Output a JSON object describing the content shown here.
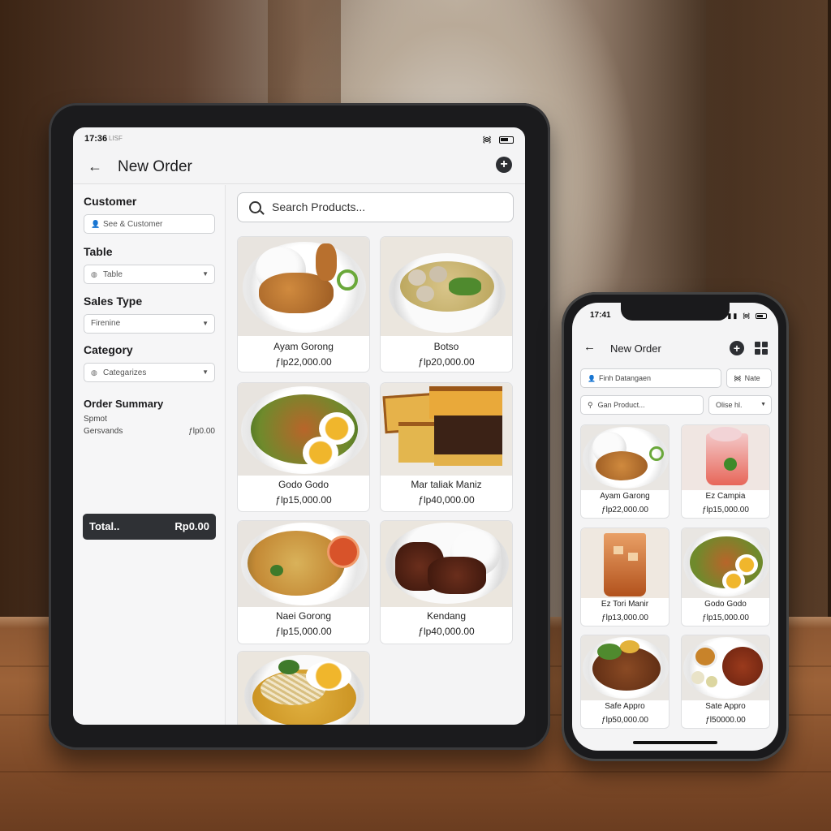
{
  "tablet": {
    "status": {
      "time": "17:36",
      "carrier": "LISF",
      "wifi_icon": "wifi-icon",
      "battery_icon": "battery-icon"
    },
    "header": {
      "title": "New Order",
      "back_icon": "arrow-left-icon",
      "add_icon": "plus-circle-icon"
    },
    "sidebar": {
      "customer_label": "Customer",
      "customer_placeholder": "See & Customer",
      "table_label": "Table",
      "table_value": "Table",
      "sales_type_label": "Sales Type",
      "sales_type_value": "Firenine",
      "category_label": "Category",
      "category_value": "Categarizes",
      "summary_label": "Order Summary",
      "summary_rows": [
        {
          "label": "Spmot",
          "value": ""
        },
        {
          "label": "Gersvands",
          "value": "ƒlp0.00"
        }
      ],
      "total_label": "Total..",
      "total_value": "Rp0.00"
    },
    "search_placeholder": "Search Products...",
    "products": [
      {
        "name": "Ayam Gorong",
        "price": "ƒlp22,000.00"
      },
      {
        "name": "Botso",
        "price": "ƒlp20,000.00"
      },
      {
        "name": "Godo Godo",
        "price": "ƒlp15,000.00"
      },
      {
        "name": "Mar taliak Maniz",
        "price": "ƒlp40,000.00"
      },
      {
        "name": "Naei Gorong",
        "price": "ƒlp15,000.00"
      },
      {
        "name": "Kendang",
        "price": "ƒlp40,000.00"
      },
      {
        "name": "",
        "price": ""
      }
    ]
  },
  "phone": {
    "status": {
      "time": "17:41"
    },
    "header": {
      "title": "New Order",
      "back_icon": "arrow-left-icon",
      "add_icon": "plus-circle-icon",
      "grid_icon": "grid-icon"
    },
    "customer_field": "Finh Datangaen",
    "network_field": "Nate",
    "search_placeholder": "Gan Product...",
    "filter_value": "Olise hl.",
    "products": [
      {
        "name": "Ayam Garong",
        "price": "ƒlp22,000.00"
      },
      {
        "name": "Ez Campia",
        "price": "ƒlp15,000.00"
      },
      {
        "name": "Ez Tori Manir",
        "price": "ƒlp13,000.00"
      },
      {
        "name": "Godo Godo",
        "price": "ƒlp15,000.00"
      },
      {
        "name": "Safe Appro",
        "price": "ƒlp50,000.00"
      },
      {
        "name": "Sate Appro",
        "price": "ƒl50000.00"
      }
    ]
  }
}
